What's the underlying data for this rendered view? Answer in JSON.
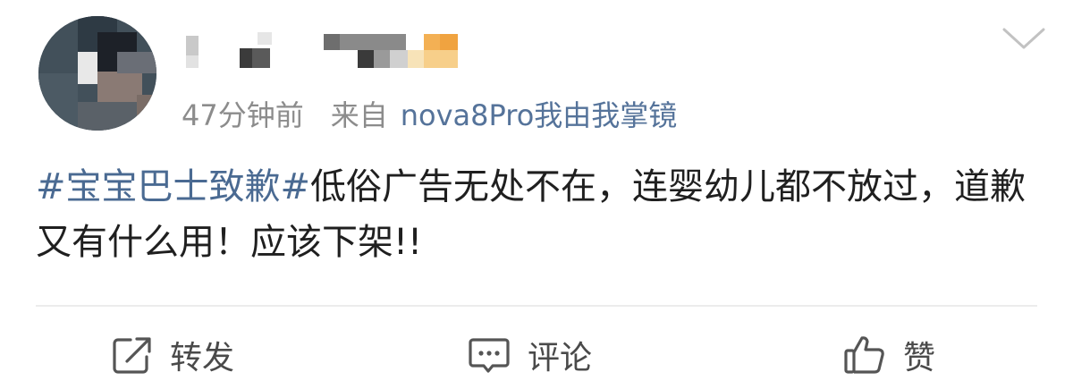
{
  "post": {
    "time_ago": "47分钟前",
    "source_label": "来自",
    "source_device": "nova8Pro我由我掌镜",
    "hashtag": "#宝宝巴士致歉#",
    "body": "低俗广告无处不在，连婴幼儿都不放过，道歉又有什么用！应该下架!!"
  },
  "actions": {
    "repost_label": "转发",
    "comment_label": "评论",
    "like_label": "赞"
  },
  "icons": {
    "more": "chevron-down-icon",
    "repost": "share-arrow-icon",
    "comment": "comment-bubble-icon",
    "like": "thumbs-up-icon"
  },
  "colors": {
    "hashtag": "#4a6a92",
    "source_device": "#55739a",
    "meta": "#8c8c8c",
    "text": "#1f1f1f"
  }
}
